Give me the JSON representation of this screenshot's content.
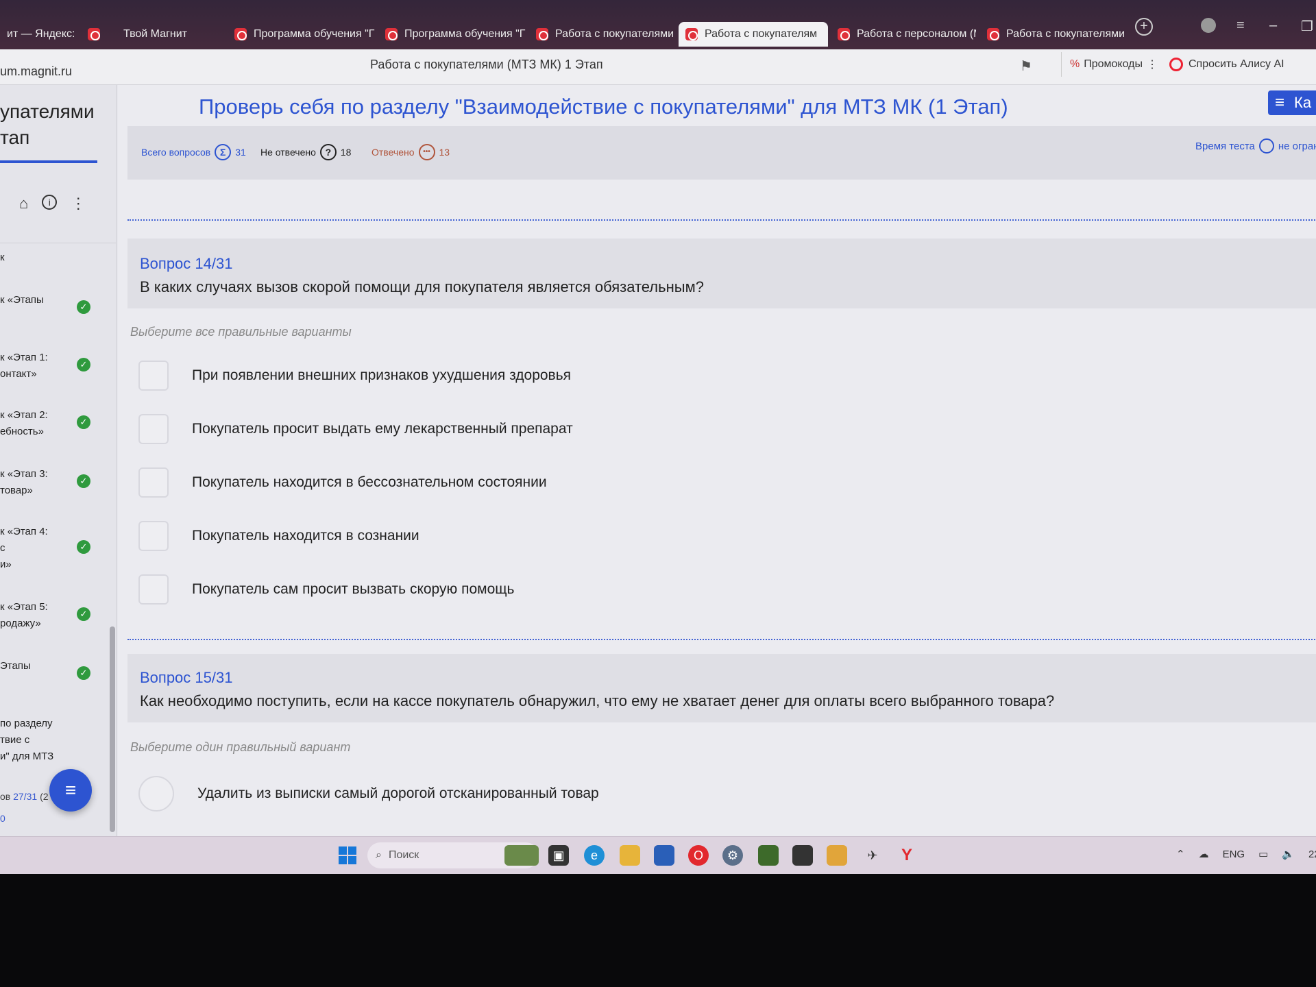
{
  "browser": {
    "tabs": [
      {
        "label": "ит — Яндекс:",
        "active": false
      },
      {
        "label": "Твой Магнит",
        "active": false
      },
      {
        "label": "Программа обучения \"Г",
        "active": false
      },
      {
        "label": "Программа обучения \"Г",
        "active": false
      },
      {
        "label": "Работа с покупателями",
        "active": false
      },
      {
        "label": "Работа с покупателям",
        "active": true
      },
      {
        "label": "Работа с персоналом (М",
        "active": false
      },
      {
        "label": "Работа с покупателями",
        "active": false
      }
    ],
    "url": "um.magnit.ru",
    "page_title": "Работа с покупателями (МТЗ МК) 1 Этап",
    "promo_label": "Промокоды",
    "alice_label": "Спросить Алису AI",
    "accent": "#2d54d1"
  },
  "sidebar": {
    "course_line1": "упателями",
    "course_line2": "тап",
    "items": [
      {
        "line1": "к",
        "line2": "",
        "line3": "",
        "done": false
      },
      {
        "line1": "к «Этапы",
        "line2": "",
        "line3": "",
        "done": true
      },
      {
        "line1": "к «Этап 1:",
        "line2": "онтакт»",
        "line3": "",
        "done": true
      },
      {
        "line1": "к «Этап 2:",
        "line2": "ебность»",
        "line3": "",
        "done": true
      },
      {
        "line1": "к «Этап 3:",
        "line2": "товар»",
        "line3": "",
        "done": true
      },
      {
        "line1": "к «Этап 4:",
        "line2": "с",
        "line3": "и»",
        "done": true
      },
      {
        "line1": "к «Этап 5:",
        "line2": "родажу»",
        "line3": "",
        "done": true
      },
      {
        "line1": "Этапы",
        "line2": "",
        "line3": "",
        "done": true
      }
    ],
    "test_item": {
      "line1": "по разделу",
      "line2": "твие с",
      "line3": "и\" для МТЗ"
    },
    "progress_prefix": "ов",
    "progress_value": "27/31",
    "progress_suffix": "(2",
    "footer_zero": "0"
  },
  "test": {
    "title": "Проверь себя по разделу \"Взаимодействие с покупателями\" для МТЗ МК (1 Этап)",
    "menu_label": "Ка",
    "stats": {
      "total_label": "Всего вопросов",
      "total_value": "31",
      "unanswered_label": "Не отвечено",
      "unanswered_value": "18",
      "answered_label": "Отвечено",
      "answered_value": "13"
    },
    "timer_label": "Время теста",
    "timer_value": "не ограни"
  },
  "questions": [
    {
      "number": "Вопрос 14/31",
      "text": "В каких случаях вызов скорой помощи для покупателя является обязательным?",
      "hint": "Выберите все правильные варианты",
      "type": "checkbox",
      "options": [
        "При появлении внешних признаков ухудшения здоровья",
        "Покупатель просит выдать ему лекарственный препарат",
        "Покупатель находится в бессознательном состоянии",
        "Покупатель находится в сознании",
        "Покупатель сам просит вызвать скорую помощь"
      ]
    },
    {
      "number": "Вопрос 15/31",
      "text": "Как необходимо поступить, если на кассе покупатель обнаружил, что ему не хватает денег для оплаты всего выбранного товара?",
      "hint": "Выберите один правильный вариант",
      "type": "radio",
      "options": [
        "Удалить из выписки самый дорогой отсканированный товар"
      ]
    }
  ],
  "taskbar": {
    "search_placeholder": "Поиск",
    "language": "ENG",
    "clock_fragment": "22"
  }
}
